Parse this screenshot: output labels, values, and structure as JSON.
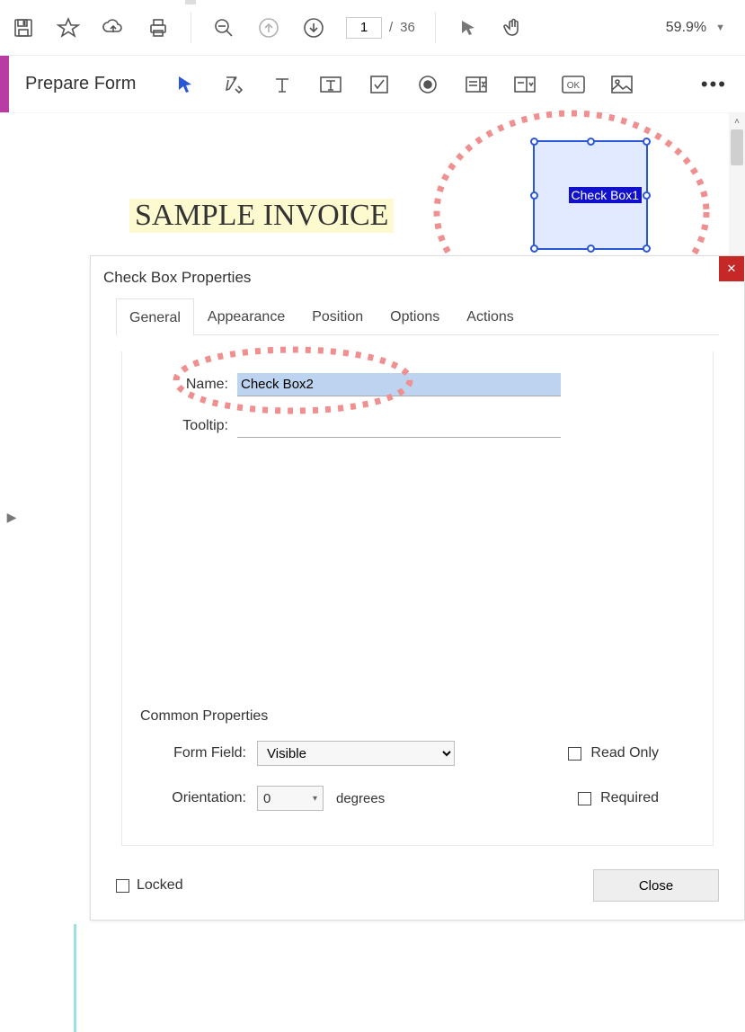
{
  "toolbar": {
    "page_current": "1",
    "page_sep": "/",
    "page_total": "36",
    "zoom": "59.9%"
  },
  "formbar": {
    "title": "Prepare Form"
  },
  "document": {
    "heading": "SAMPLE INVOICE",
    "field_label": "Check Box1"
  },
  "dialog": {
    "title": "Check Box Properties",
    "tabs": {
      "general": "General",
      "appearance": "Appearance",
      "position": "Position",
      "options": "Options",
      "actions": "Actions"
    },
    "fields": {
      "name_label": "Name:",
      "name_value": "Check Box2",
      "tooltip_label": "Tooltip:",
      "tooltip_value": ""
    },
    "common": {
      "title": "Common Properties",
      "form_field_label": "Form Field:",
      "form_field_value": "Visible",
      "orientation_label": "Orientation:",
      "orientation_value": "0",
      "degrees": "degrees",
      "read_only": "Read Only",
      "required": "Required"
    },
    "footer": {
      "locked": "Locked",
      "close": "Close"
    }
  }
}
